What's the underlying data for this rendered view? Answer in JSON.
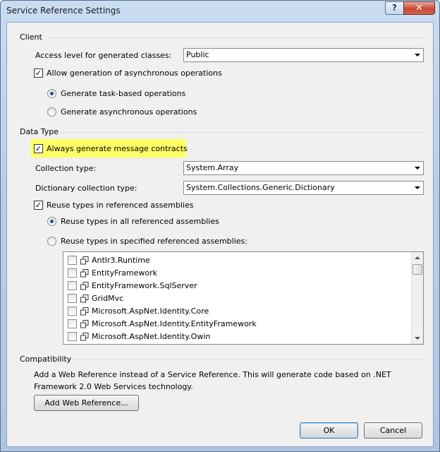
{
  "window": {
    "title": "Service Reference Settings",
    "help_label": "?",
    "close_label": "✕"
  },
  "client": {
    "section_label": "Client",
    "access_level_label": "Access level for generated classes:",
    "access_level_value": "Public",
    "allow_async_label": "Allow generation of asynchronous operations",
    "allow_async_checked": true,
    "task_based_label": "Generate task-based operations",
    "task_based_selected": true,
    "async_ops_label": "Generate asynchronous operations",
    "async_ops_selected": false
  },
  "data_type": {
    "section_label": "Data Type",
    "always_generate_label": "Always generate message contracts",
    "always_generate_checked": true,
    "highlight_color": "#ffff66",
    "collection_type_label": "Collection type:",
    "collection_type_value": "System.Array",
    "dictionary_type_label": "Dictionary collection type:",
    "dictionary_type_value": "System.Collections.Generic.Dictionary",
    "reuse_types_label": "Reuse types in referenced assemblies",
    "reuse_types_checked": true,
    "reuse_all_label": "Reuse types in all referenced assemblies",
    "reuse_all_selected": true,
    "reuse_specified_label": "Reuse types in specified referenced assemblies:",
    "reuse_specified_selected": false,
    "assemblies": [
      {
        "name": "Antlr3.Runtime",
        "checked": false
      },
      {
        "name": "EntityFramework",
        "checked": false
      },
      {
        "name": "EntityFramework.SqlServer",
        "checked": false
      },
      {
        "name": "GridMvc",
        "checked": false
      },
      {
        "name": "Microsoft.AspNet.Identity.Core",
        "checked": false
      },
      {
        "name": "Microsoft.AspNet.Identity.EntityFramework",
        "checked": false
      },
      {
        "name": "Microsoft.AspNet.Identity.Owin",
        "checked": false
      }
    ]
  },
  "compatibility": {
    "section_label": "Compatibility",
    "description": "Add a Web Reference instead of a Service Reference. This will generate code based on .NET Framework 2.0 Web Services technology.",
    "add_web_reference_label": "Add Web Reference..."
  },
  "footer": {
    "ok_label": "OK",
    "cancel_label": "Cancel"
  },
  "icons": {
    "help": "help-icon",
    "close": "close-icon",
    "dropdown": "chevron-down-icon",
    "assembly": "assembly-reference-icon",
    "check": "checkmark-icon"
  },
  "colors": {
    "title_bar": "#b9cfe9",
    "close_button": "#c7473a",
    "dialog_background": "#f0f0f0",
    "radio_dot": "#1f4f9e"
  }
}
